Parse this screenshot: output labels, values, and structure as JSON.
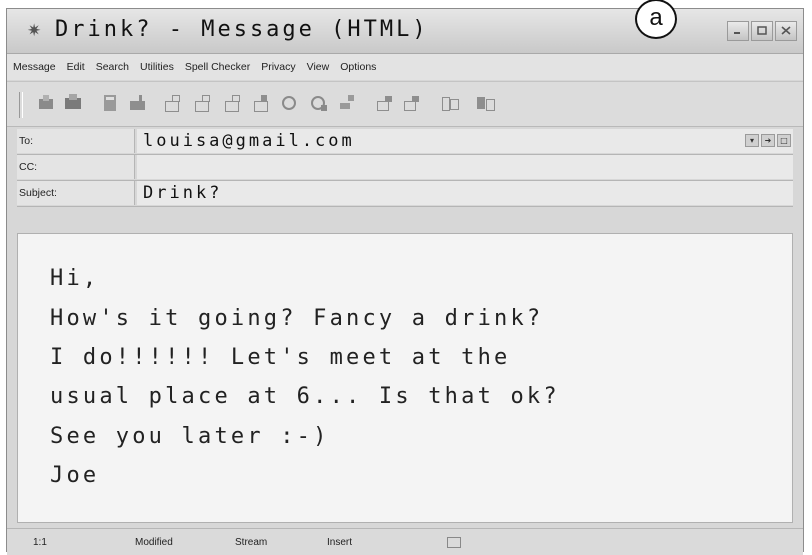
{
  "annotation": "a",
  "window": {
    "title": "Drink? - Message (HTML)"
  },
  "menu": [
    "Message",
    "Edit",
    "Search",
    "Utilities",
    "Spell Checker",
    "Privacy",
    "View",
    "Options"
  ],
  "toolbar": {
    "icons": [
      "send-icon",
      "send-later-icon",
      "save-icon",
      "attach-icon",
      "address-icon",
      "priority-icon",
      "check-names-icon",
      "spell-icon",
      "encrypt-icon",
      "sign-icon",
      "options-icon",
      "reply-icon",
      "forward-icon",
      "format-icon",
      "close-icon"
    ]
  },
  "headers": {
    "to_label": "To:",
    "to_value": "louisa@gmail.com",
    "cc_label": "CC:",
    "cc_value": "",
    "subject_label": "Subject:",
    "subject_value": "Drink?"
  },
  "body_lines": [
    "Hi,",
    "How's it going? Fancy a drink?",
    "I do!!!!!! Let's meet at the",
    "usual place at 6... Is that ok?",
    "See you later :-)",
    "Joe"
  ],
  "status": {
    "position": "1:1",
    "modified": "Modified",
    "stream": "Stream",
    "insert": "Insert"
  }
}
